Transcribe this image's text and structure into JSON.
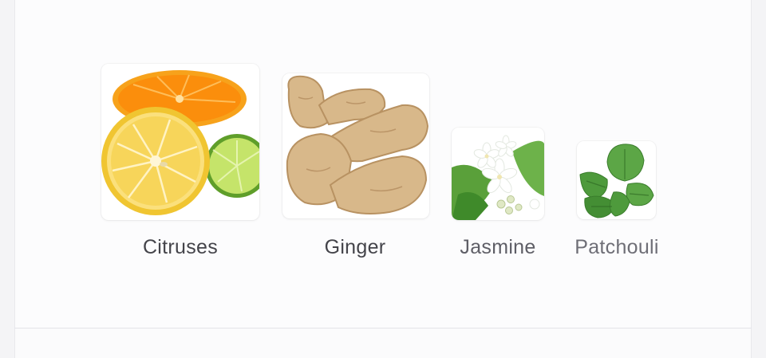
{
  "notes": [
    {
      "name": "Citruses",
      "icon": "citrus-fruits-icon"
    },
    {
      "name": "Ginger",
      "icon": "ginger-root-icon"
    },
    {
      "name": "Jasmine",
      "icon": "jasmine-flower-icon"
    },
    {
      "name": "Patchouli",
      "icon": "patchouli-leaves-icon"
    }
  ],
  "colors": {
    "card_background": "#fcfcfd",
    "page_background": "#f4f4f6",
    "label_dark": "#44444a",
    "label_light": "#6e6e76"
  }
}
